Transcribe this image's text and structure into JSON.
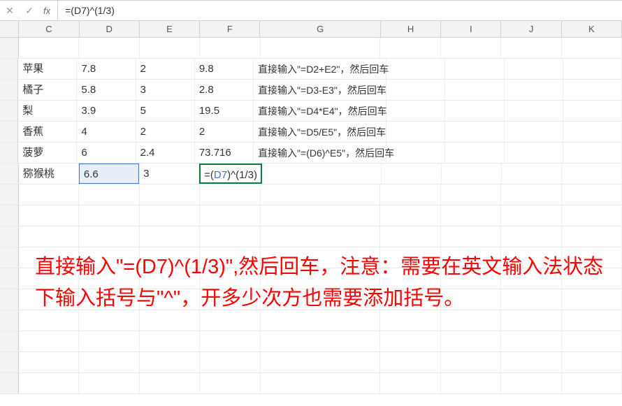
{
  "chart_data": {
    "type": "table",
    "title": "",
    "columns": [
      "C",
      "D",
      "E",
      "F",
      "G"
    ],
    "rows": [
      {
        "C": "苹果",
        "D": 7.8,
        "E": 2,
        "F": 9.8,
        "G": "直接输入\"=D2+E2\"，然后回车"
      },
      {
        "C": "橘子",
        "D": 5.8,
        "E": 3,
        "F": 2.8,
        "G": "直接输入\"=D3-E3\"，然后回车"
      },
      {
        "C": "梨",
        "D": 3.9,
        "E": 5,
        "F": 19.5,
        "G": "直接输入\"=D4*E4\"，然后回车"
      },
      {
        "C": "香蕉",
        "D": 4,
        "E": 2,
        "F": 2,
        "G": "直接输入\"=D5/E5\"，然后回车"
      },
      {
        "C": "菠萝",
        "D": 6,
        "E": 2.4,
        "F": 73.716,
        "G": "直接输入\"=(D6)^E5\"，然后回车"
      },
      {
        "C": "猕猴桃",
        "D": 6.6,
        "E": 3,
        "F": "=(D7)^(1/3)",
        "G": ""
      }
    ]
  },
  "formulaBar": {
    "cancel": "✕",
    "accept": "✓",
    "fx": "fx",
    "formula": "=(D7)^(1/3)"
  },
  "columns": [
    "C",
    "D",
    "E",
    "F",
    "G",
    "H",
    "I",
    "J",
    "K"
  ],
  "data": {
    "r1": {
      "C": "",
      "D": "",
      "E": "",
      "F": "",
      "G": ""
    },
    "r2": {
      "C": "苹果",
      "D": "7.8",
      "E": "2",
      "F": "9.8",
      "G": "直接输入\"=D2+E2\"，然后回车"
    },
    "r3": {
      "C": "橘子",
      "D": "5.8",
      "E": "3",
      "F": "2.8",
      "G": "直接输入\"=D3-E3\"，然后回车"
    },
    "r4": {
      "C": "梨",
      "D": "3.9",
      "E": "5",
      "F": "19.5",
      "G": "直接输入\"=D4*E4\"，然后回车"
    },
    "r5": {
      "C": "香蕉",
      "D": "4",
      "E": "2",
      "F": "2",
      "G": "直接输入\"=D5/E5\"，然后回车"
    },
    "r6": {
      "C": "菠萝",
      "D": "6",
      "E": "2.4",
      "F": "73.716",
      "G": "直接输入\"=(D6)^E5\"，然后回车"
    },
    "r7": {
      "C": "猕猴桃",
      "D": "6.6",
      "E": "3",
      "F_pre": "=(",
      "F_ref": "D7",
      "F_post": ")^(1/3)",
      "G": ""
    }
  },
  "overlay": "直接输入\"=(D7)^(1/3)\",然后回车，注意：需要在英文输入法状态下输入括号与\"^\"，开多少次方也需要添加括号。"
}
